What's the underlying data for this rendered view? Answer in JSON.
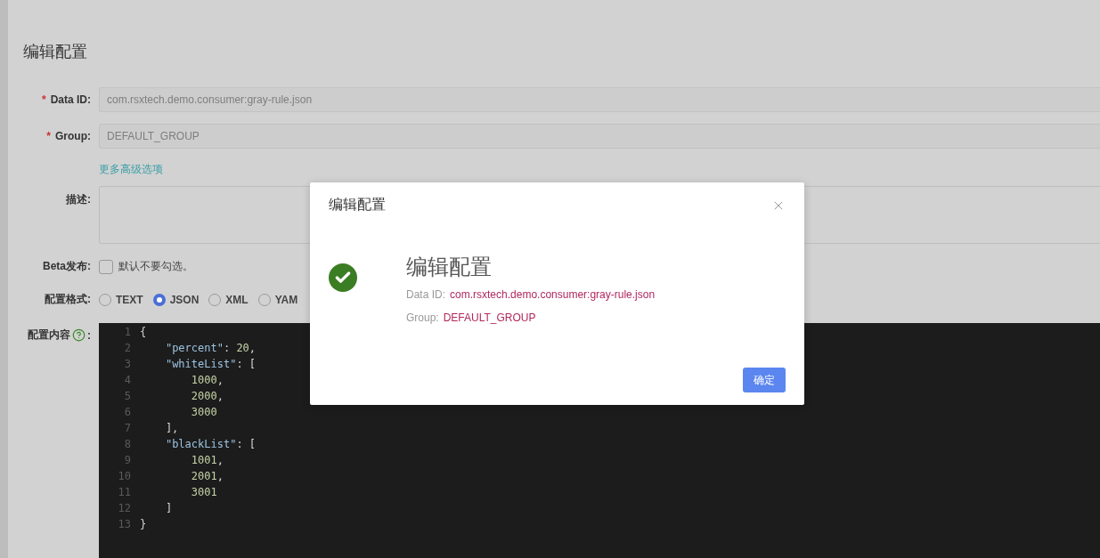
{
  "page": {
    "title": "编辑配置",
    "fields": [
      {
        "mark": "*",
        "label": "Data ID:",
        "value": "com.rsxtech.demo.consumer:gray-rule.json"
      },
      {
        "mark": "*",
        "label": "Group:",
        "value": "DEFAULT_GROUP"
      }
    ],
    "advanced_link": "更多高级选项",
    "description": {
      "label": "描述:"
    },
    "beta": {
      "label": "Beta发布:",
      "checked": false,
      "text": "默认不要勾选。"
    },
    "format": {
      "label": "配置格式:",
      "options": [
        {
          "label": "TEXT",
          "selected": false
        },
        {
          "label": "JSON",
          "selected": true
        },
        {
          "label": "XML",
          "selected": false
        },
        {
          "label": "YAM",
          "selected": false
        }
      ]
    },
    "content": {
      "label": "配置内容",
      "suffix": ":",
      "lines": [
        {
          "number": "1",
          "text": "{"
        },
        {
          "number": "2",
          "text": "    \"percent\": 20,"
        },
        {
          "number": "3",
          "text": "    \"whiteList\": ["
        },
        {
          "number": "4",
          "text": "        1000,"
        },
        {
          "number": "5",
          "text": "        2000,"
        },
        {
          "number": "6",
          "text": "        3000"
        },
        {
          "number": "7",
          "text": "    ],"
        },
        {
          "number": "8",
          "text": "    \"blackList\": ["
        },
        {
          "number": "9",
          "text": "        1001,"
        },
        {
          "number": "10",
          "text": "        2001,"
        },
        {
          "number": "11",
          "text": "        3001"
        },
        {
          "number": "12",
          "text": "    ]"
        },
        {
          "number": "13",
          "text": "}"
        }
      ]
    }
  },
  "dialog": {
    "title": "编辑配置",
    "heading": "编辑配置",
    "details": [
      {
        "label": "Data ID:",
        "value": "com.rsxtech.demo.consumer:gray-rule.json"
      },
      {
        "label": "Group:",
        "value": "DEFAULT_GROUP"
      }
    ],
    "ok_button": "确定"
  }
}
